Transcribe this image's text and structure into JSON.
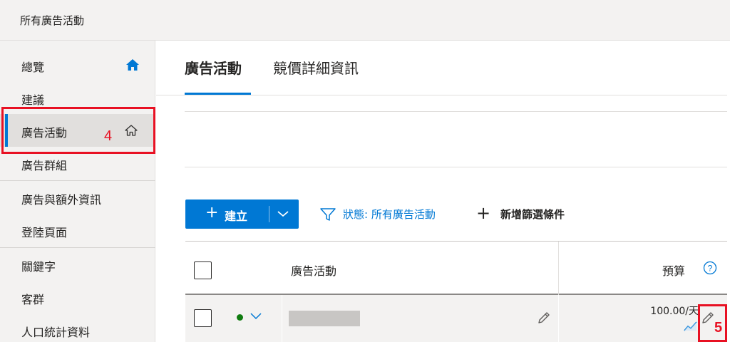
{
  "header": {
    "title": "所有廣告活動"
  },
  "sidebar": {
    "items": [
      {
        "label": "總覽"
      },
      {
        "label": "建議"
      },
      {
        "label": "廣告活動"
      },
      {
        "label": "廣告群組"
      },
      {
        "label": "廣告與額外資訊"
      },
      {
        "label": "登陸頁面"
      },
      {
        "label": "關鍵字"
      },
      {
        "label": "客群"
      },
      {
        "label": "人口統計資料"
      }
    ]
  },
  "annotations": {
    "step4": "4",
    "step5": "5"
  },
  "tabs": [
    {
      "label": "廣告活動",
      "selected": true
    },
    {
      "label": "競價詳細資訊",
      "selected": false
    }
  ],
  "toolbar": {
    "create_label": "建立",
    "status_filter": "狀態: 所有廣告活動",
    "add_filter": "新增篩選條件"
  },
  "table": {
    "columns": {
      "campaign": "廣告活動",
      "budget": "預算"
    },
    "rows": [
      {
        "budget": "100.00/天",
        "status": "active"
      }
    ]
  },
  "colors": {
    "accent": "#0078d4",
    "annotation": "#e81123",
    "status_active": "#107c10"
  }
}
